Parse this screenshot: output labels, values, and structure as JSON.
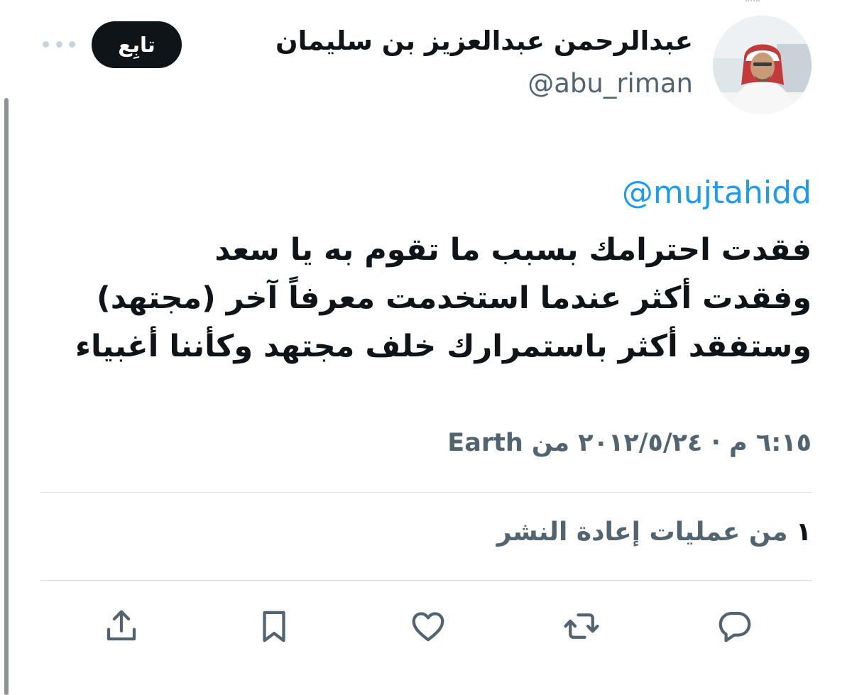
{
  "author": {
    "display_name": "عبدالرحمن عبدالعزيز بن سليمان",
    "handle": "@abu_riman",
    "avatar_icon": "profile-photo"
  },
  "follow_button": {
    "label": "تابِع"
  },
  "more_icon": "ellipsis-icon",
  "tweet": {
    "mention": "@mujtahidd",
    "lines": [
      "فقدت احترامك بسبب ما تقوم به يا سعد",
      "وفقدت أكثر عندما استخدمت معرفاً آخر (مجتهد)",
      "وستفقد أكثر باستمرارك خلف مجتهد وكأننا أغبياء"
    ]
  },
  "meta": {
    "datetime": "٦:١٥ م · ٢٠١٢/٥/٢٤",
    "from_label": "من",
    "source": "Earth"
  },
  "stats": {
    "reposts_count": "١",
    "reposts_label": "من عمليات إعادة النشر"
  },
  "actions": [
    {
      "name": "reply-icon"
    },
    {
      "name": "repost-icon"
    },
    {
      "name": "like-icon"
    },
    {
      "name": "bookmark-icon"
    },
    {
      "name": "share-icon"
    }
  ],
  "colors": {
    "accent": "#1d9bf0",
    "text": "#0f1419",
    "muted": "#536471",
    "divider": "#d9dee2",
    "button_bg": "#0f1419"
  }
}
